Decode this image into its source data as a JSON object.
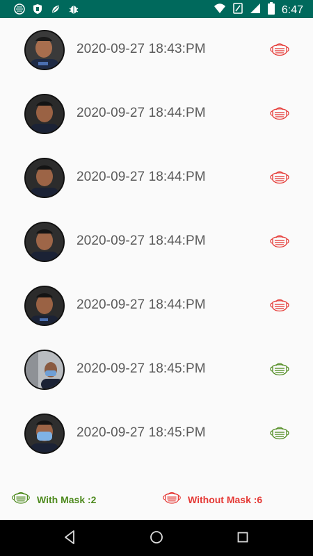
{
  "status_bar": {
    "time": "6:47",
    "icons": [
      "circle-icon",
      "shield-icon",
      "paw-icon",
      "bug-icon",
      "wifi-icon",
      "battery-saver-icon",
      "signal-icon",
      "battery-icon"
    ]
  },
  "records": [
    {
      "timestamp": "2020-09-27 18:43:PM",
      "mask": false
    },
    {
      "timestamp": "2020-09-27 18:44:PM",
      "mask": false
    },
    {
      "timestamp": "2020-09-27 18:44:PM",
      "mask": false
    },
    {
      "timestamp": "2020-09-27 18:44:PM",
      "mask": false
    },
    {
      "timestamp": "2020-09-27 18:44:PM",
      "mask": false
    },
    {
      "timestamp": "2020-09-27 18:45:PM",
      "mask": true
    },
    {
      "timestamp": "2020-09-27 18:45:PM",
      "mask": true
    }
  ],
  "footer": {
    "with_mask_label": "With Mask :2",
    "without_mask_label": "Without Mask :6"
  },
  "colors": {
    "status_bar": "#00695c",
    "with_mask": "#4e8a1e",
    "without_mask": "#e53935",
    "timestamp_text": "#5a5a5a"
  },
  "nav": {
    "icons": [
      "back-icon",
      "home-icon",
      "recents-icon"
    ]
  }
}
